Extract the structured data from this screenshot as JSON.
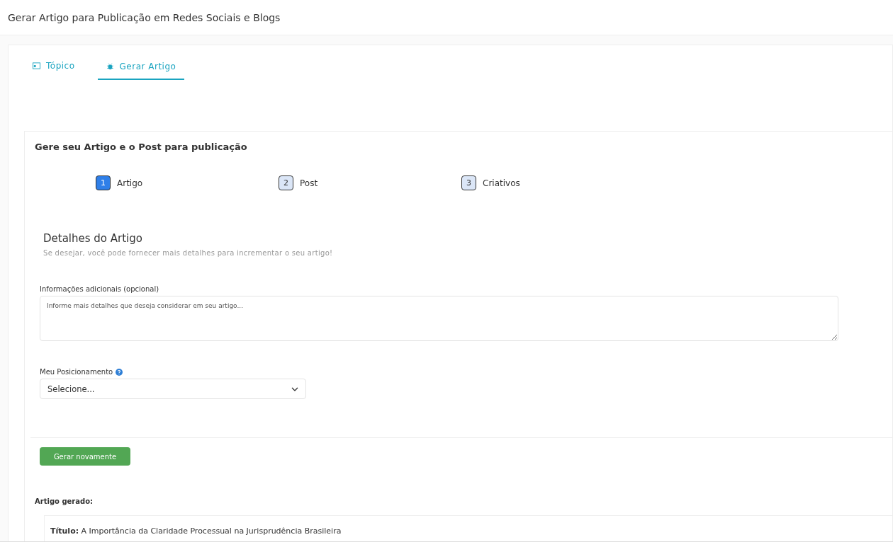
{
  "page_title": "Gerar Artigo para Publicação em Redes Sociais e Blogs",
  "tabs": [
    {
      "label": "Tópico",
      "selected": false
    },
    {
      "label": "Gerar Artigo",
      "selected": true
    }
  ],
  "card_title": "Gere seu Artigo e o Post para publicação",
  "steps": [
    {
      "number": "1",
      "label": "Artigo",
      "selected": true
    },
    {
      "number": "2",
      "label": "Post",
      "selected": false
    },
    {
      "number": "3",
      "label": "Criativos",
      "selected": false
    }
  ],
  "section": {
    "title": "Detalhes do Artigo",
    "subtitle": "Se desejar, você pode fornecer mais detalhes para incrementar o seu artigo!"
  },
  "additional_info": {
    "label": "Informações adicionais (opcional)",
    "placeholder": "Informe mais detalhes que deseja considerar em seu artigo..."
  },
  "positioning": {
    "label": "Meu Posicionamento",
    "value": "Selecione..."
  },
  "regenerate_button": "Gerar novamente",
  "result": {
    "heading": "Artigo gerado:",
    "title_line": "**Título:** A Importância da Claridade Processual na Jurisprudência Brasileira"
  }
}
